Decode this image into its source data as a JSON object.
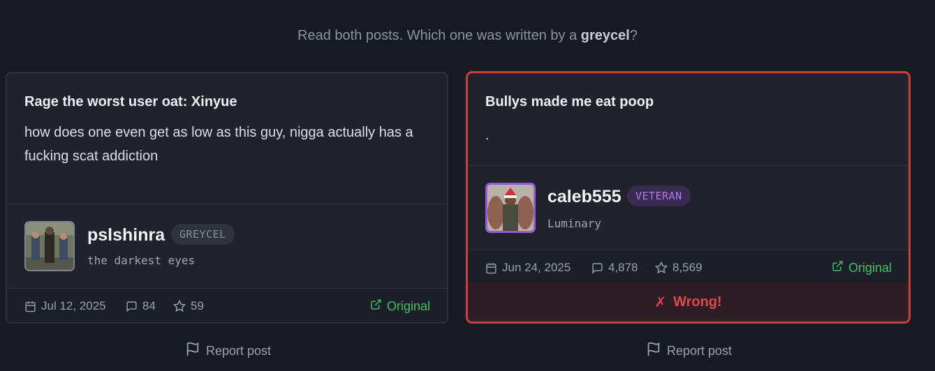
{
  "prompt": {
    "prefix": "Read both posts. Which one was written by a ",
    "emphasis": "greycel",
    "suffix": "?"
  },
  "posts": [
    {
      "title": "Rage the worst user oat: Xinyue",
      "body": "how does one even get as low as this guy, nigga actually has a fucking scat addiction",
      "username": "pslshinra",
      "badge": "GREYCEL",
      "tagline": "the darkest eyes",
      "date": "Jul 12, 2025",
      "comments": "84",
      "stars": "59",
      "original_label": "Original",
      "report_label": "Report post"
    },
    {
      "title": "Bullys made me eat poop",
      "body": ".",
      "username": "caleb555",
      "badge": "VETERAN",
      "tagline": "Luminary",
      "date": "Jun 24, 2025",
      "comments": "4,878",
      "stars": "8,569",
      "original_label": "Original",
      "verdict_icon": "✗",
      "verdict_label": "Wrong!",
      "report_label": "Report post"
    }
  ],
  "colors": {
    "background": "#161a22",
    "card": "#1f232c",
    "wrong_border": "#d43c3c",
    "original_link": "#3fbf6a",
    "veteran_badge": "#b07ae6"
  },
  "icons": [
    "calendar-icon",
    "comment-icon",
    "star-icon",
    "external-link-icon",
    "flag-icon"
  ]
}
